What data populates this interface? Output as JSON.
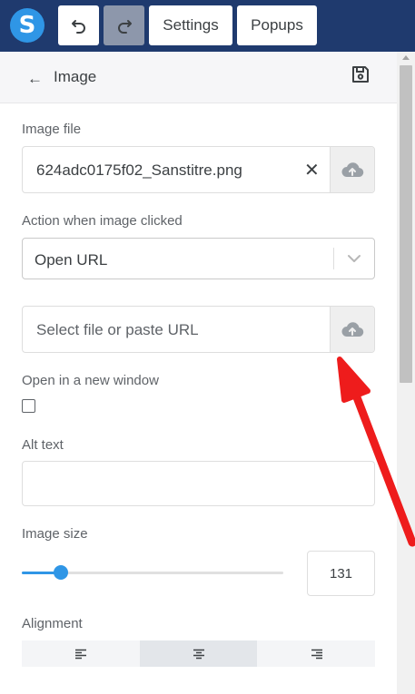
{
  "toolbar": {
    "logo_letter": "S",
    "settings_label": "Settings",
    "popups_label": "Popups"
  },
  "panel": {
    "title": "Image",
    "back_arrow": "←"
  },
  "image_file": {
    "label": "Image file",
    "value": "624adc0175f02_Sanstitre.png",
    "clear_glyph": "✕"
  },
  "action": {
    "label": "Action when image clicked",
    "selected": "Open URL"
  },
  "url_field": {
    "placeholder": "Select file or paste URL"
  },
  "new_window": {
    "label": "Open in a new window",
    "checked": false
  },
  "alt_text": {
    "label": "Alt text",
    "value": ""
  },
  "image_size": {
    "label": "Image size",
    "value": "131"
  },
  "alignment": {
    "label": "Alignment",
    "options": [
      "left",
      "center",
      "right"
    ],
    "selected": "center"
  },
  "colors": {
    "topbar": "#1f3a6e",
    "accent": "#2f96e6",
    "annotation_arrow": "#ee1c1c"
  },
  "icons": [
    "undo-icon",
    "redo-icon",
    "save-icon",
    "cloud-upload-icon",
    "chevron-down-icon",
    "align-left-icon",
    "align-center-icon",
    "align-right-icon"
  ]
}
